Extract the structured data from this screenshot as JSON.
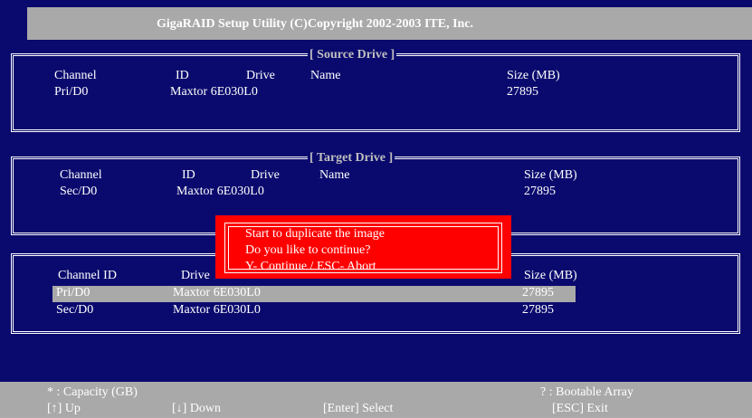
{
  "app": {
    "title": "GigaRAID Setup Utility (C)Copyright 2002-2003 ITE, Inc."
  },
  "source": {
    "title": "[ Source Drive ]",
    "headers": [
      "Channel",
      "ID",
      "Drive",
      "Name",
      "Size (MB)"
    ],
    "row": {
      "channel": "Pri/D0",
      "drive": "Maxtor  6E030L0",
      "size": "27895"
    }
  },
  "target": {
    "title": "[ Target Drive ]",
    "headers": [
      "Channel",
      "ID",
      "Drive",
      "Name",
      "Size (MB)"
    ],
    "row": {
      "channel": "Sec/D0",
      "drive": "Maxtor  6E030L0",
      "size": "27895"
    }
  },
  "list": {
    "headers": [
      "Channel  ID",
      "Drive",
      "Size (MB)"
    ],
    "rows": [
      {
        "channel": "Pri/D0",
        "drive": "Maxtor  6E030L0",
        "size": "27895"
      },
      {
        "channel": "Sec/D0",
        "drive": "Maxtor  6E030L0",
        "size": "27895"
      }
    ]
  },
  "dialog": {
    "line1": "Start to duplicate the image",
    "line2": "Do you like to continue?",
    "line3": "Y- Continue / ESC- Abort"
  },
  "footer": {
    "capacity": "* : Capacity (GB)",
    "bootable": "?    : Bootable Array",
    "up": "[↑] Up",
    "down": "[↓]  Down",
    "select": "[Enter] Select",
    "exit": "[ESC] Exit"
  },
  "colors": {
    "background": "#0a0a6e",
    "bar": "#a9a9a9",
    "dialog": "#ff0000"
  }
}
